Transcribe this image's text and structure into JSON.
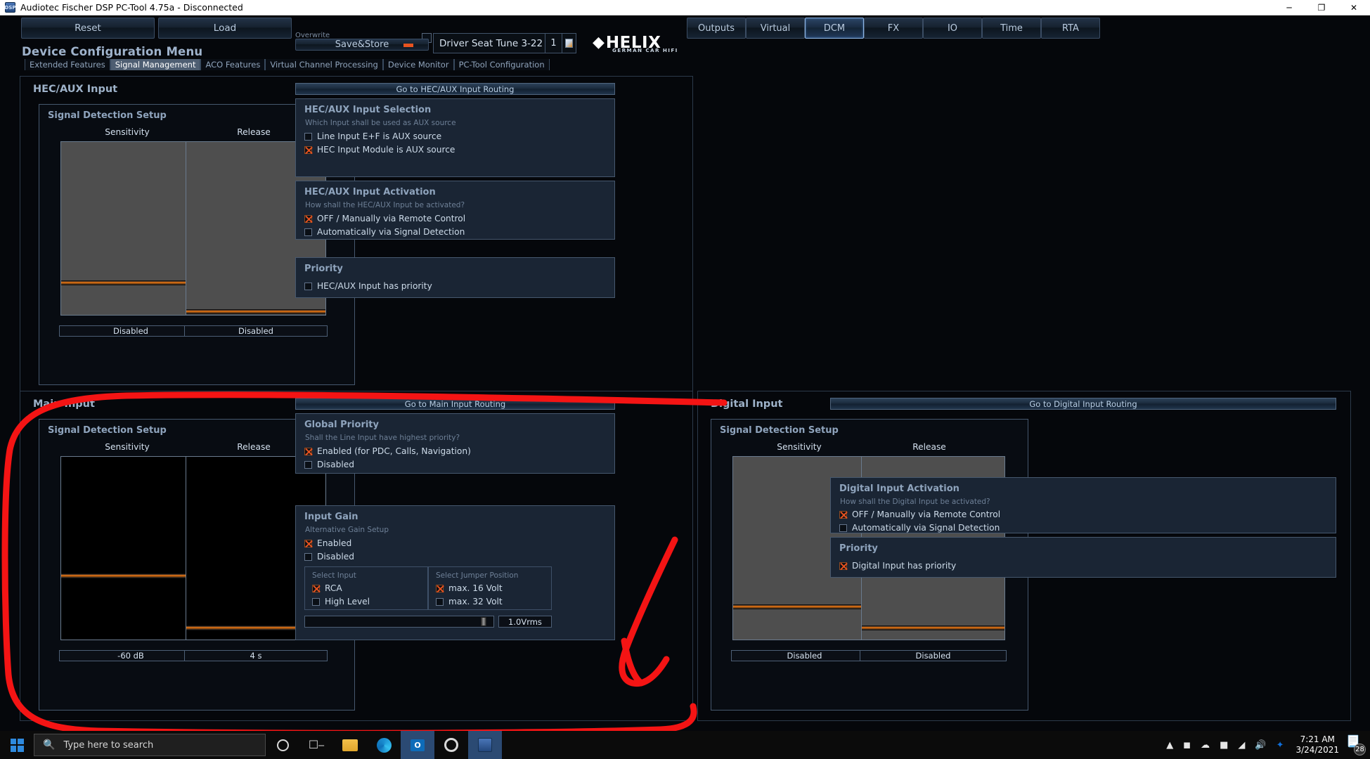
{
  "window": {
    "title": "Audiotec Fischer DSP PC-Tool 4.75a - Disconnected",
    "icon": "dsp-app-icon",
    "minimize": "─",
    "maximize": "❐",
    "close": "✕"
  },
  "toolbar": {
    "reset": "Reset",
    "load": "Load",
    "overwrite_label": "Overwrite",
    "save_store": "Save&Store",
    "preset_name": "Driver Seat Tune 3-22",
    "preset_number": "1",
    "brand": "HELIX",
    "brand_sub": "GERMAN CAR HIFI",
    "nav": [
      {
        "label": "Outputs",
        "active": false
      },
      {
        "label": "Virtual",
        "active": false
      },
      {
        "label": "DCM",
        "active": true
      },
      {
        "label": "FX",
        "active": false
      },
      {
        "label": "IO",
        "active": false
      },
      {
        "label": "Time",
        "active": false
      },
      {
        "label": "RTA",
        "active": false
      }
    ]
  },
  "dcm": {
    "title": "Device Configuration Menu",
    "tabs": [
      {
        "label": "Extended Features",
        "selected": false
      },
      {
        "label": "Signal Management",
        "selected": true
      },
      {
        "label": "ACO Features",
        "selected": false
      },
      {
        "label": "Virtual Channel Processing",
        "selected": false
      },
      {
        "label": "Device Monitor",
        "selected": false
      },
      {
        "label": "PC-Tool Configuration",
        "selected": false
      }
    ]
  },
  "hec_aux": {
    "panel_title": "HEC/AUX Input",
    "route_button": "Go to HEC/AUX Input Routing",
    "detection": {
      "title": "Signal Detection Setup",
      "sensitivity_label": "Sensitivity",
      "release_label": "Release",
      "sensitivity_value": "Disabled",
      "release_value": "Disabled"
    },
    "selection": {
      "title": "HEC/AUX Input Selection",
      "subtitle": "Which Input shall be used as AUX source",
      "options": [
        {
          "label": "Line Input E+F is AUX source",
          "checked": false
        },
        {
          "label": "HEC Input Module is AUX source",
          "checked": true
        }
      ]
    },
    "activation": {
      "title": "HEC/AUX Input Activation",
      "subtitle": "How shall the HEC/AUX Input be activated?",
      "options": [
        {
          "label": "OFF / Manually via Remote Control",
          "checked": true
        },
        {
          "label": "Automatically via Signal Detection",
          "checked": false
        }
      ]
    },
    "priority": {
      "title": "Priority",
      "options": [
        {
          "label": "HEC/AUX Input has priority",
          "checked": false
        }
      ]
    }
  },
  "main_input": {
    "panel_title": "Main Input",
    "route_button": "Go to Main Input Routing",
    "detection": {
      "title": "Signal Detection Setup",
      "sensitivity_label": "Sensitivity",
      "release_label": "Release",
      "sensitivity_value": "-60 dB",
      "release_value": "4 s"
    },
    "global_priority": {
      "title": "Global Priority",
      "subtitle": "Shall the Line Input have highest priority?",
      "options": [
        {
          "label": "Enabled (for PDC, Calls, Navigation)",
          "checked": true
        },
        {
          "label": "Disabled",
          "checked": false
        }
      ]
    },
    "input_gain": {
      "title": "Input Gain",
      "subtitle": "Alternative Gain Setup",
      "options": [
        {
          "label": "Enabled",
          "checked": true
        },
        {
          "label": "Disabled",
          "checked": false
        }
      ],
      "select_input": {
        "title": "Select Input",
        "options": [
          {
            "label": "RCA",
            "checked": true
          },
          {
            "label": "High Level",
            "checked": false
          }
        ]
      },
      "select_jumper": {
        "title": "Select Jumper Position",
        "options": [
          {
            "label": "max. 16 Volt",
            "checked": true
          },
          {
            "label": "max. 32 Volt",
            "checked": false
          }
        ]
      },
      "gain_value": "1.0Vrms"
    }
  },
  "digital_input": {
    "panel_title": "Digital Input",
    "route_button": "Go to Digital Input Routing",
    "detection": {
      "title": "Signal Detection Setup",
      "sensitivity_label": "Sensitivity",
      "release_label": "Release",
      "sensitivity_value": "Disabled",
      "release_value": "Disabled"
    },
    "activation": {
      "title": "Digital Input Activation",
      "subtitle": "How shall the Digital Input be activated?",
      "options": [
        {
          "label": "OFF / Manually via Remote Control",
          "checked": true
        },
        {
          "label": "Automatically via Signal Detection",
          "checked": false
        }
      ]
    },
    "priority": {
      "title": "Priority",
      "options": [
        {
          "label": "Digital Input has priority",
          "checked": true
        }
      ]
    }
  },
  "annotation": {
    "color": "#f41414",
    "shapes": [
      "rounded-rectangle-around-main-input",
      "down-arrow-to-input-gain"
    ]
  },
  "taskbar": {
    "start": "windows-start-icon",
    "search_placeholder": "Type here to search",
    "search_icon": "search-icon",
    "items": [
      "cortana-icon",
      "task-view-icon",
      "file-explorer-icon",
      "edge-browser-icon",
      "outlook-icon",
      "settings-icon",
      "dsp-pc-tool-icon"
    ],
    "tray": {
      "chevron": "show-hidden-icons",
      "icons": [
        "camera-icon",
        "onedrive-icon",
        "battery-icon",
        "wifi-icon",
        "volume-icon",
        "dropbox-icon"
      ],
      "time": "7:21 AM",
      "date": "3/24/2021",
      "notification_count": "28"
    }
  }
}
